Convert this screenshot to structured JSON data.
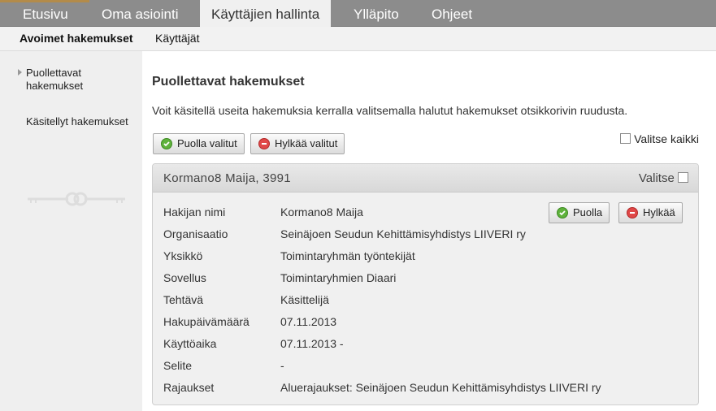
{
  "topnav": {
    "tabs": [
      {
        "label": "Etusivu"
      },
      {
        "label": "Oma asiointi"
      },
      {
        "label": "Käyttäjien hallinta"
      },
      {
        "label": "Ylläpito"
      },
      {
        "label": "Ohjeet"
      }
    ]
  },
  "subnav": {
    "items": [
      {
        "label": "Avoimet hakemukset"
      },
      {
        "label": "Käyttäjät"
      }
    ]
  },
  "sidebar": {
    "items": [
      {
        "label_line1": "Puollettavat",
        "label_line2": "hakemukset"
      },
      {
        "label": "Käsitellyt hakemukset"
      }
    ]
  },
  "main": {
    "title": "Puollettavat hakemukset",
    "intro": "Voit käsitellä useita hakemuksia kerralla valitsemalla halutut hakemukset otsikkorivin ruudusta.",
    "approve_selected": "Puolla valitut",
    "reject_selected": "Hylkää valitut",
    "select_all": "Valitse kaikki"
  },
  "application": {
    "title": "Kormano8 Maija, 3991",
    "select_label": "Valitse",
    "approve": "Puolla",
    "reject": "Hylkää",
    "fields": [
      {
        "label": "Hakijan nimi",
        "value": "Kormano8 Maija"
      },
      {
        "label": "Organisaatio",
        "value": "Seinäjoen Seudun Kehittämisyhdistys LIIVERI ry"
      },
      {
        "label": "Yksikkö",
        "value": "Toimintaryhmän työntekijät"
      },
      {
        "label": "Sovellus",
        "value": "Toimintaryhmien Diaari"
      },
      {
        "label": "Tehtävä",
        "value": "Käsittelijä"
      },
      {
        "label": "Hakupäivämäärä",
        "value": "07.11.2013"
      },
      {
        "label": "Käyttöaika",
        "value": "07.11.2013 -"
      },
      {
        "label": "Selite",
        "value": "-"
      },
      {
        "label": "Rajaukset",
        "value": "Aluerajaukset: Seinäjoen Seudun Kehittämisyhdistys LIIVERI ry"
      }
    ]
  },
  "colors": {
    "topnav_bg": "#8c8c8c",
    "approve_icon": "#5fb23c",
    "reject_icon": "#e04848"
  }
}
